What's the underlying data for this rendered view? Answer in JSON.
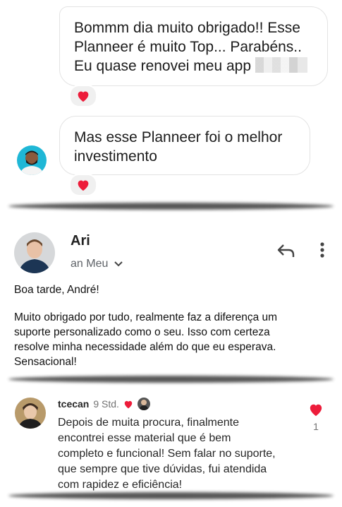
{
  "chat": {
    "message1_lines": [
      "Bommm dia muito obrigado!! Esse",
      "Planneer é muito Top... Parabéns..",
      "Eu quase renovei meu app"
    ],
    "message2_lines": [
      "Mas esse Planneer foi o melhor",
      "investimento"
    ],
    "reaction_icon": "heart-icon"
  },
  "email": {
    "sender": "Ari",
    "recipient": "an Meu",
    "greeting": "Boa tarde, André!",
    "body_lines": [
      "Muito obrigado por tudo, realmente faz a diferença um",
      "suporte personalizado como o seu. Isso com certeza",
      "resolve minha necessidade além do que eu esperava.",
      "Sensacional!"
    ]
  },
  "comment": {
    "username": "tcecan",
    "time": "9 Std.",
    "text_lines": [
      "Depois de muita procura, finalmente",
      "encontrei esse material que é bem",
      "completo e funcional! Sem falar no suporte,",
      "que sempre que tive dúvidas, fui atendida",
      "com rapidez e eficiência!"
    ],
    "like_count": "1"
  },
  "colors": {
    "heart": "#ed1c3a",
    "bubble_border": "#e3e3e3",
    "muted_text": "#5f6368"
  }
}
